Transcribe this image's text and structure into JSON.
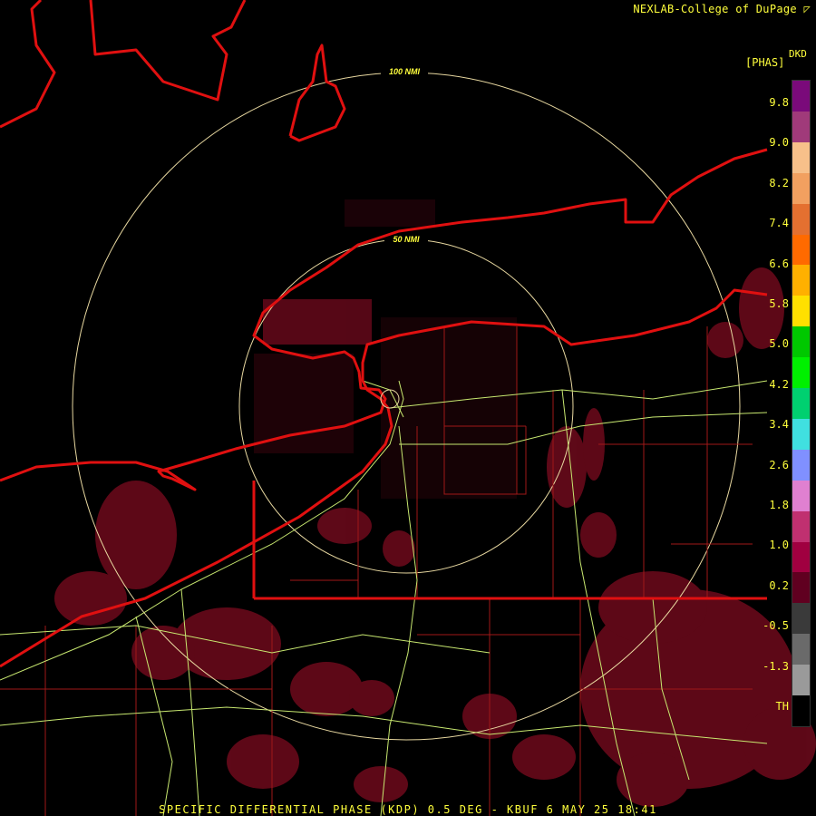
{
  "credit": "NEXLAB-College of DuPage",
  "credit_mark": "◸",
  "footer": "SPECIFIC DIFFERENTIAL PHASE (KDP) 0.5 DEG - KBUF 6 MAY 25 18:41",
  "rings": [
    {
      "label": "100 NMI",
      "range_nmi": 100
    },
    {
      "label": "50 NMI",
      "range_nmi": 50
    }
  ],
  "legend": {
    "product": "DKD",
    "unit": "[PHAS]",
    "ticks": [
      "9.8",
      "9.0",
      "8.2",
      "7.4",
      "6.6",
      "5.8",
      "5.0",
      "4.2",
      "3.4",
      "2.6",
      "1.8",
      "1.0",
      "0.2",
      "-0.5",
      "-1.3",
      "TH"
    ],
    "colors": [
      "#7a0a7a",
      "#a03a7a",
      "#f7c08a",
      "#f2a060",
      "#e47030",
      "#ff6a00",
      "#ffb000",
      "#ffe000",
      "#00c800",
      "#00f000",
      "#00d070",
      "#40e0e0",
      "#8090ff",
      "#e080d0",
      "#c03070",
      "#a00040",
      "#600020",
      "#3a3a3a",
      "#6a6a6a",
      "#9a9a9a",
      "#000000"
    ],
    "colors_meaning": "scale from top (highest) to bottom (lowest/TH)"
  },
  "colors": {
    "background": "#000000",
    "state_borders": "#e01010",
    "county_borders": "#a01818",
    "highways": "#c8e870",
    "rings": "#e8d8a0",
    "echoes": "#7a0a20",
    "text": "#ffff3c"
  }
}
